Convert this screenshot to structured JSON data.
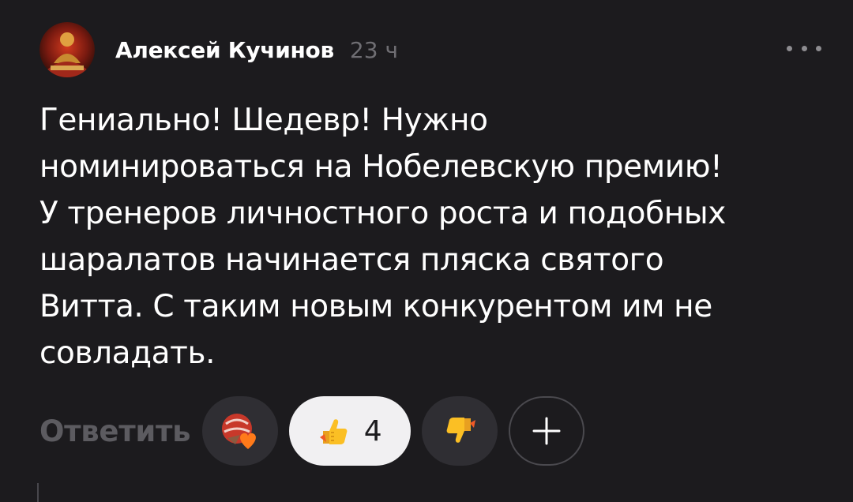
{
  "comment": {
    "author": "Алексей Кучинов",
    "time": "23 ч",
    "text": "Гениально! Шедевр! Нужно\nноминироваться на Нобелевскую премию!\nУ тренеров личностного роста и подобных\nшаралатов начинается пляска святого\nВитта. С таким новым конкурентом им не\nсовладать."
  },
  "actions": {
    "reply_label": "Ответить",
    "like_count": "4"
  },
  "icons": {
    "more": "more-dots-icon",
    "reaction": "reaction-sticker-icon",
    "like": "thumbs-up-icon",
    "dislike": "thumbs-down-icon",
    "add": "plus-icon"
  },
  "colors": {
    "background": "#1c1b1e",
    "secondary_text": "#6f6e73",
    "reply_text": "#5c5b60",
    "pill": "#2f2e33",
    "pill_active": "#f1f0f2"
  }
}
